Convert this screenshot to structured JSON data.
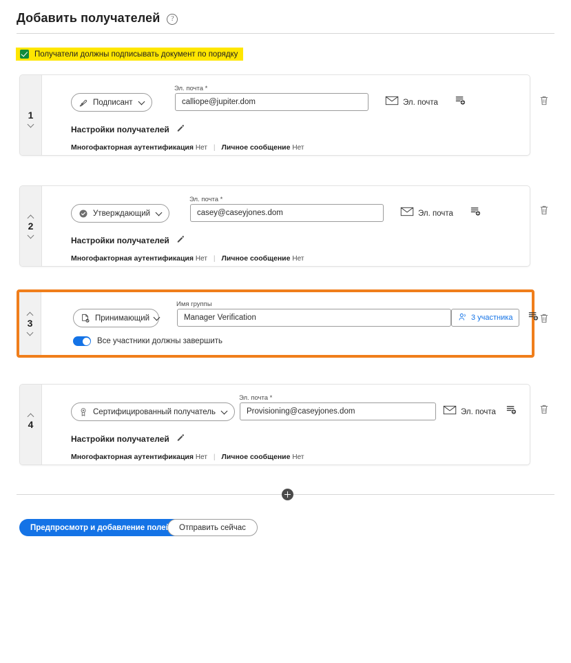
{
  "header": {
    "title": "Добавить получателей",
    "help_icon": "help-circle-icon"
  },
  "order_banner": {
    "label": "Получатели должны подписывать документ по порядку",
    "checked": true,
    "highlight_color": "#FFE600",
    "checkbox_color": "#0F8B3C"
  },
  "highlight_color": "#F07E1B",
  "accent_color": "#1473E6",
  "recipients": [
    {
      "number": "1",
      "role": "Подписант",
      "role_icon": "signature-pen-icon",
      "field_label": "Эл. почта",
      "field_required": "*",
      "field_value": "calliope@jupiter.dom",
      "delivery_label": "Эл. почта",
      "delivery_icon": "envelope-icon",
      "add_field_icon": "add-form-field-icon",
      "delete_icon": "trash-icon",
      "settings_label": "Настройки получателей",
      "settings_edit_icon": "pencil-icon",
      "meta": [
        {
          "key": "Многофакторная аутентификация",
          "value": "Нет"
        },
        {
          "key": "Личное сообщение",
          "value": "Нет"
        }
      ],
      "move_up": false,
      "move_down": true
    },
    {
      "number": "2",
      "role": "Утверждающий",
      "role_icon": "check-circle-icon",
      "field_label": "Эл. почта",
      "field_required": "*",
      "field_value": "casey@caseyjones.dom",
      "delivery_label": "Эл. почта",
      "delivery_icon": "envelope-icon",
      "add_field_icon": "add-form-field-icon",
      "delete_icon": "trash-icon",
      "settings_label": "Настройки получателей",
      "settings_edit_icon": "pencil-icon",
      "meta": [
        {
          "key": "Многофакторная аутентификация",
          "value": "Нет"
        },
        {
          "key": "Личное сообщение",
          "value": "Нет"
        }
      ],
      "move_up": true,
      "move_down": true
    },
    {
      "number": "3",
      "role": "Принимающий",
      "role_icon": "document-accept-icon",
      "field_label": "Имя группы",
      "field_required": "",
      "field_value": "Manager Verification",
      "members_label": "3 участника",
      "members_icon": "people-icon",
      "add_field_icon": "add-form-field-icon",
      "delete_icon": "trash-icon",
      "toggle_label": "Все участники должны завершить",
      "toggle_on": true,
      "highlighted": true,
      "move_up": true,
      "move_down": true
    },
    {
      "number": "4",
      "role": "Сертифицированный получатель",
      "role_icon": "certificate-ribbon-icon",
      "field_label": "Эл. почта",
      "field_required": "*",
      "field_value": "Provisioning@caseyjones.dom",
      "delivery_label": "Эл. почта",
      "delivery_icon": "envelope-icon",
      "add_field_icon": "add-form-field-icon",
      "delete_icon": "trash-icon",
      "settings_label": "Настройки получателей",
      "settings_edit_icon": "pencil-icon",
      "meta": [
        {
          "key": "Многофакторная аутентификация",
          "value": "Нет"
        },
        {
          "key": "Личное сообщение",
          "value": "Нет"
        }
      ],
      "move_up": true,
      "move_down": false
    }
  ],
  "add_recipient": {
    "icon": "plus-circle-icon"
  },
  "footer": {
    "primary_label": "Предпросмотр и добавление полей",
    "secondary_label": "Отправить сейчас"
  }
}
